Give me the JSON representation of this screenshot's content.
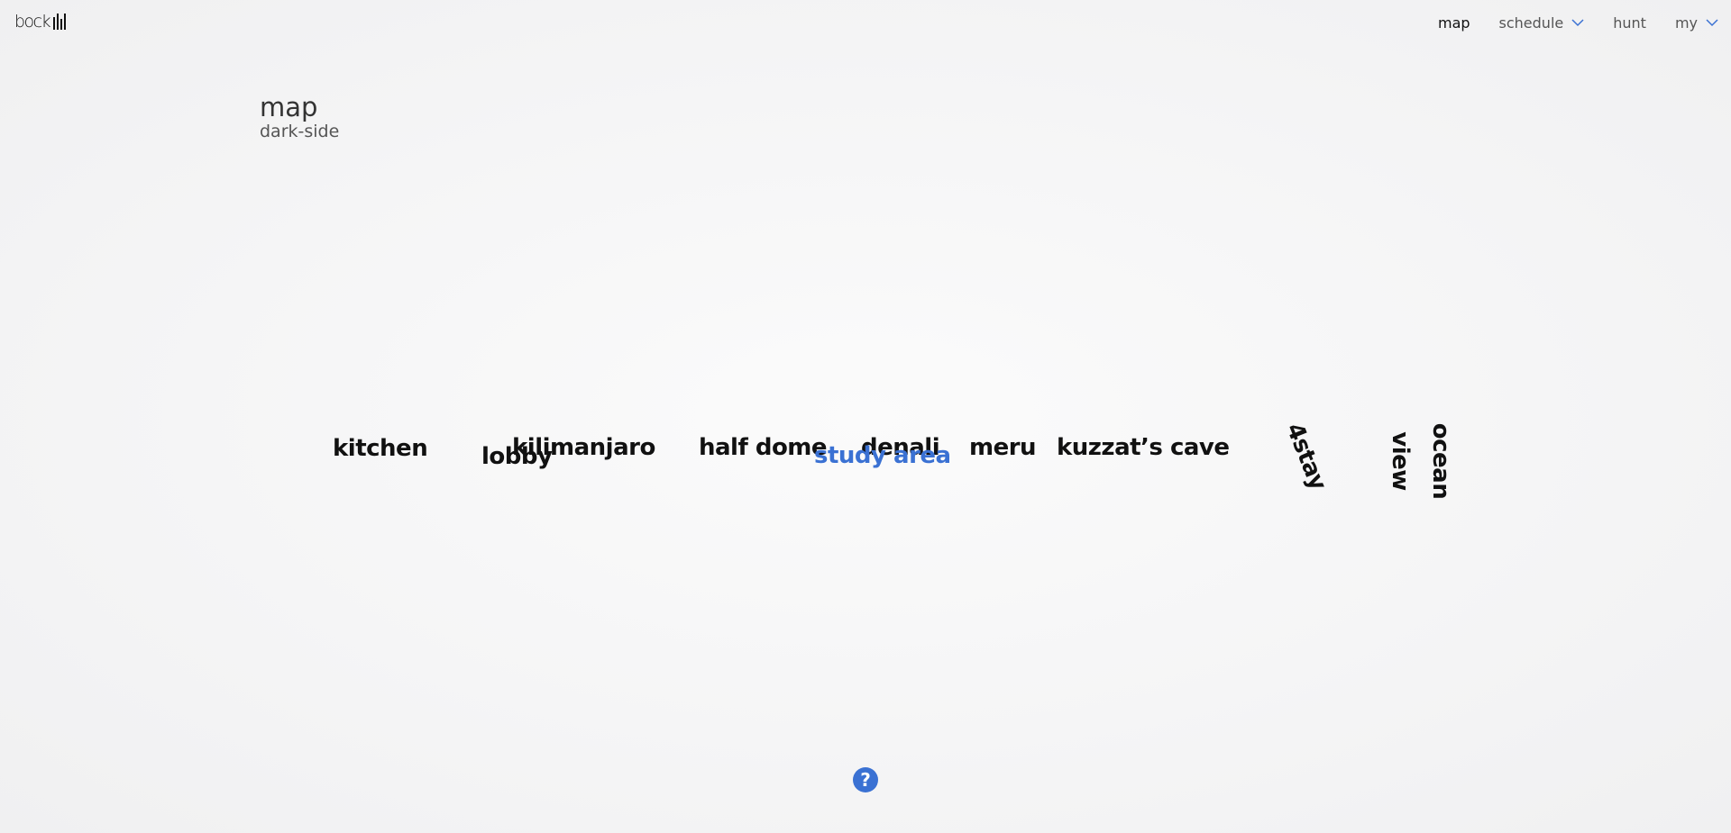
{
  "app": {
    "logo_text": "bock"
  },
  "nav": {
    "items": [
      {
        "label": "map",
        "active": true,
        "has_dropdown": false
      },
      {
        "label": "schedule",
        "active": false,
        "has_dropdown": true
      },
      {
        "label": "hunt",
        "active": false,
        "has_dropdown": false
      },
      {
        "label": "my",
        "active": false,
        "has_dropdown": true
      }
    ],
    "dropdown_icon": "chevron-down-icon",
    "accent_color": "#3a71d3"
  },
  "page": {
    "title": "map",
    "subtitle": "dark-side"
  },
  "map": {
    "rooms": {
      "kitchen": "kitchen",
      "lobby": "lobby",
      "kilimanjaro": "kilimanjaro",
      "half_dome": "half dome",
      "study_area": "study area",
      "denali": "denali",
      "meru": "meru",
      "kuzzats_cave": "kuzzat’s cave",
      "four_stay": "4stay",
      "view": "view",
      "ocean": "ocean"
    },
    "highlighted_room": "study area",
    "highlight_color": "#3a71d3"
  },
  "help": {
    "icon": "question-mark-icon",
    "label": "?"
  }
}
